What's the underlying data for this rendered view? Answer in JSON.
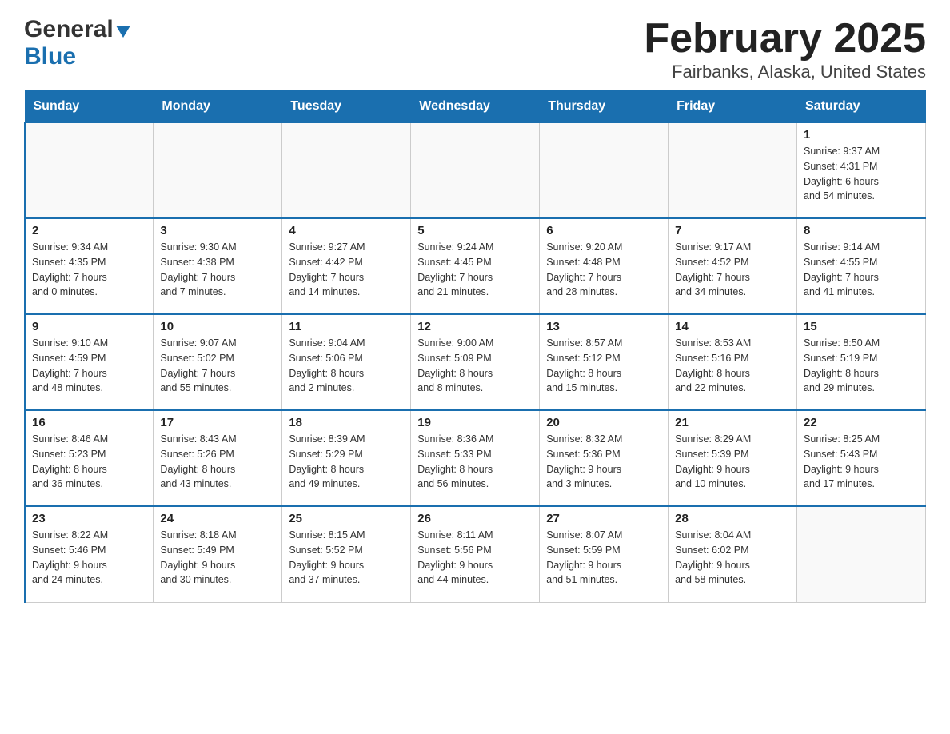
{
  "header": {
    "logo_general": "General",
    "logo_blue": "Blue",
    "title": "February 2025",
    "subtitle": "Fairbanks, Alaska, United States"
  },
  "weekdays": [
    "Sunday",
    "Monday",
    "Tuesday",
    "Wednesday",
    "Thursday",
    "Friday",
    "Saturday"
  ],
  "weeks": [
    [
      {
        "day": "",
        "info": ""
      },
      {
        "day": "",
        "info": ""
      },
      {
        "day": "",
        "info": ""
      },
      {
        "day": "",
        "info": ""
      },
      {
        "day": "",
        "info": ""
      },
      {
        "day": "",
        "info": ""
      },
      {
        "day": "1",
        "info": "Sunrise: 9:37 AM\nSunset: 4:31 PM\nDaylight: 6 hours\nand 54 minutes."
      }
    ],
    [
      {
        "day": "2",
        "info": "Sunrise: 9:34 AM\nSunset: 4:35 PM\nDaylight: 7 hours\nand 0 minutes."
      },
      {
        "day": "3",
        "info": "Sunrise: 9:30 AM\nSunset: 4:38 PM\nDaylight: 7 hours\nand 7 minutes."
      },
      {
        "day": "4",
        "info": "Sunrise: 9:27 AM\nSunset: 4:42 PM\nDaylight: 7 hours\nand 14 minutes."
      },
      {
        "day": "5",
        "info": "Sunrise: 9:24 AM\nSunset: 4:45 PM\nDaylight: 7 hours\nand 21 minutes."
      },
      {
        "day": "6",
        "info": "Sunrise: 9:20 AM\nSunset: 4:48 PM\nDaylight: 7 hours\nand 28 minutes."
      },
      {
        "day": "7",
        "info": "Sunrise: 9:17 AM\nSunset: 4:52 PM\nDaylight: 7 hours\nand 34 minutes."
      },
      {
        "day": "8",
        "info": "Sunrise: 9:14 AM\nSunset: 4:55 PM\nDaylight: 7 hours\nand 41 minutes."
      }
    ],
    [
      {
        "day": "9",
        "info": "Sunrise: 9:10 AM\nSunset: 4:59 PM\nDaylight: 7 hours\nand 48 minutes."
      },
      {
        "day": "10",
        "info": "Sunrise: 9:07 AM\nSunset: 5:02 PM\nDaylight: 7 hours\nand 55 minutes."
      },
      {
        "day": "11",
        "info": "Sunrise: 9:04 AM\nSunset: 5:06 PM\nDaylight: 8 hours\nand 2 minutes."
      },
      {
        "day": "12",
        "info": "Sunrise: 9:00 AM\nSunset: 5:09 PM\nDaylight: 8 hours\nand 8 minutes."
      },
      {
        "day": "13",
        "info": "Sunrise: 8:57 AM\nSunset: 5:12 PM\nDaylight: 8 hours\nand 15 minutes."
      },
      {
        "day": "14",
        "info": "Sunrise: 8:53 AM\nSunset: 5:16 PM\nDaylight: 8 hours\nand 22 minutes."
      },
      {
        "day": "15",
        "info": "Sunrise: 8:50 AM\nSunset: 5:19 PM\nDaylight: 8 hours\nand 29 minutes."
      }
    ],
    [
      {
        "day": "16",
        "info": "Sunrise: 8:46 AM\nSunset: 5:23 PM\nDaylight: 8 hours\nand 36 minutes."
      },
      {
        "day": "17",
        "info": "Sunrise: 8:43 AM\nSunset: 5:26 PM\nDaylight: 8 hours\nand 43 minutes."
      },
      {
        "day": "18",
        "info": "Sunrise: 8:39 AM\nSunset: 5:29 PM\nDaylight: 8 hours\nand 49 minutes."
      },
      {
        "day": "19",
        "info": "Sunrise: 8:36 AM\nSunset: 5:33 PM\nDaylight: 8 hours\nand 56 minutes."
      },
      {
        "day": "20",
        "info": "Sunrise: 8:32 AM\nSunset: 5:36 PM\nDaylight: 9 hours\nand 3 minutes."
      },
      {
        "day": "21",
        "info": "Sunrise: 8:29 AM\nSunset: 5:39 PM\nDaylight: 9 hours\nand 10 minutes."
      },
      {
        "day": "22",
        "info": "Sunrise: 8:25 AM\nSunset: 5:43 PM\nDaylight: 9 hours\nand 17 minutes."
      }
    ],
    [
      {
        "day": "23",
        "info": "Sunrise: 8:22 AM\nSunset: 5:46 PM\nDaylight: 9 hours\nand 24 minutes."
      },
      {
        "day": "24",
        "info": "Sunrise: 8:18 AM\nSunset: 5:49 PM\nDaylight: 9 hours\nand 30 minutes."
      },
      {
        "day": "25",
        "info": "Sunrise: 8:15 AM\nSunset: 5:52 PM\nDaylight: 9 hours\nand 37 minutes."
      },
      {
        "day": "26",
        "info": "Sunrise: 8:11 AM\nSunset: 5:56 PM\nDaylight: 9 hours\nand 44 minutes."
      },
      {
        "day": "27",
        "info": "Sunrise: 8:07 AM\nSunset: 5:59 PM\nDaylight: 9 hours\nand 51 minutes."
      },
      {
        "day": "28",
        "info": "Sunrise: 8:04 AM\nSunset: 6:02 PM\nDaylight: 9 hours\nand 58 minutes."
      },
      {
        "day": "",
        "info": ""
      }
    ]
  ]
}
